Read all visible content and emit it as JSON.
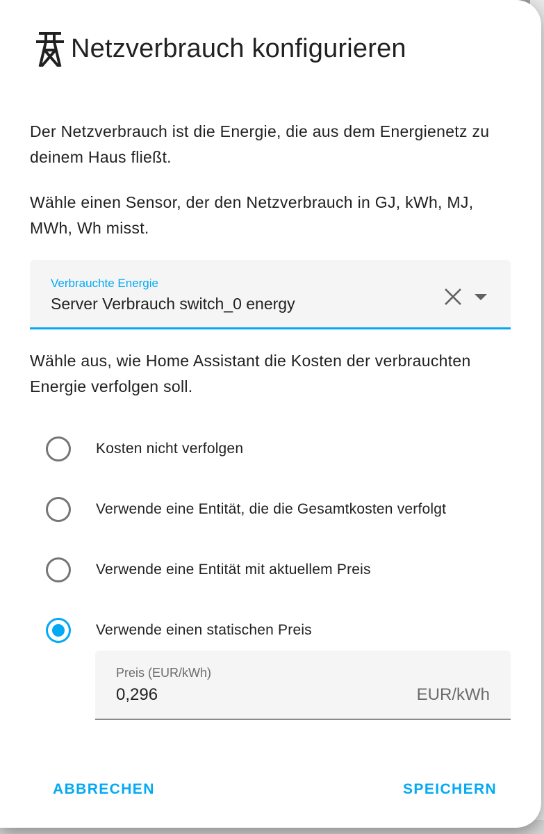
{
  "dialog": {
    "title": "Netzverbrauch konfigurieren",
    "title_icon": "transmission-tower-icon",
    "description_1": "Der Netzverbrauch ist die Energie, die aus dem Energienetz zu deinem Haus fließt.",
    "description_2": "Wähle einen Sensor, der den Netzverbrauch in GJ, kWh, MJ, MWh, Wh misst.",
    "entity_field": {
      "label": "Verbrauchte Energie",
      "value": "Server Verbrauch switch_0 energy"
    },
    "cost_prompt": "Wähle aus, wie Home Assistant die Kosten der verbrauchten Energie verfolgen soll.",
    "cost_options": [
      {
        "label": "Kosten nicht verfolgen",
        "selected": false
      },
      {
        "label": "Verwende eine Entität, die die Gesamtkosten verfolgt",
        "selected": false
      },
      {
        "label": "Verwende eine Entität mit aktuellem Preis",
        "selected": false
      },
      {
        "label": "Verwende einen statischen Preis",
        "selected": true
      }
    ],
    "price_field": {
      "label": "Preis (EUR/kWh)",
      "value": "0,296",
      "suffix": "EUR/kWh"
    },
    "cancel_label": "ABBRECHEN",
    "save_label": "SPEICHERN"
  },
  "colors": {
    "accent": "#03a9f4",
    "text": "#212121",
    "field_background": "#f5f5f5"
  }
}
